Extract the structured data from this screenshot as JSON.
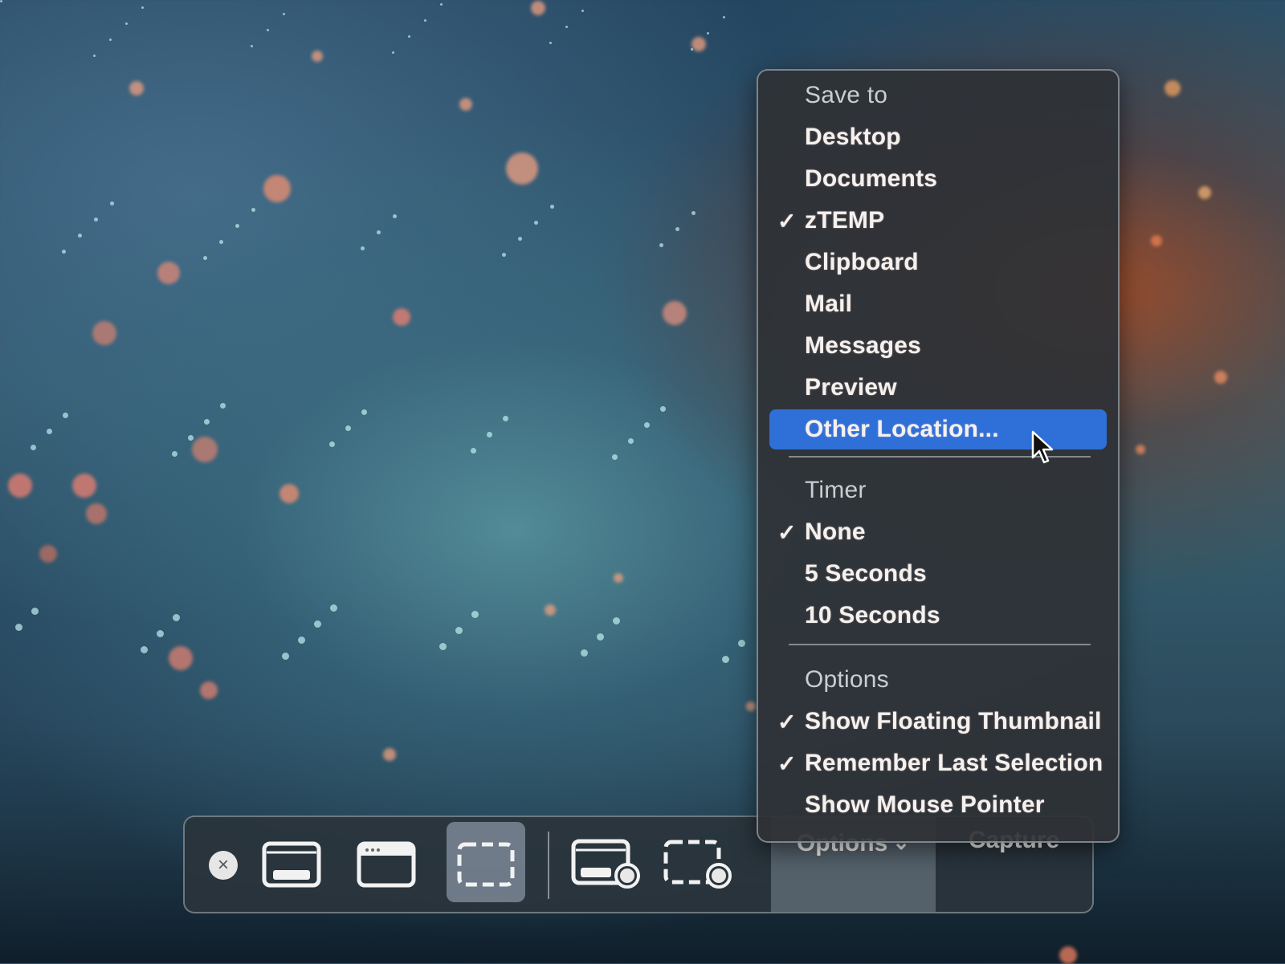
{
  "menu": {
    "sections": [
      {
        "header": "Save to",
        "items": [
          {
            "label": "Desktop",
            "checked": false
          },
          {
            "label": "Documents",
            "checked": false
          },
          {
            "label": "zTEMP",
            "checked": true
          },
          {
            "label": "Clipboard",
            "checked": false
          },
          {
            "label": "Mail",
            "checked": false
          },
          {
            "label": "Messages",
            "checked": false
          },
          {
            "label": "Preview",
            "checked": false
          },
          {
            "label": "Other Location...",
            "checked": false,
            "highlighted": true
          }
        ]
      },
      {
        "header": "Timer",
        "items": [
          {
            "label": "None",
            "checked": true
          },
          {
            "label": "5 Seconds",
            "checked": false
          },
          {
            "label": "10 Seconds",
            "checked": false
          }
        ]
      },
      {
        "header": "Options",
        "items": [
          {
            "label": "Show Floating Thumbnail",
            "checked": true
          },
          {
            "label": "Remember Last Selection",
            "checked": true
          },
          {
            "label": "Show Mouse Pointer",
            "checked": false
          }
        ]
      }
    ],
    "check_glyph": "✓",
    "highlight_color": "#2f6fd8"
  },
  "toolbar": {
    "close_icon": "×",
    "tools": [
      {
        "name": "capture-entire-screen",
        "icon": "screen-icon"
      },
      {
        "name": "capture-selected-window",
        "icon": "window-icon"
      },
      {
        "name": "capture-selected-portion",
        "icon": "dashed-rect-icon",
        "selected": true
      },
      {
        "name": "record-entire-screen",
        "icon": "screen-record-icon"
      },
      {
        "name": "record-selected-portion",
        "icon": "dashed-record-icon"
      }
    ],
    "options_label": "Options",
    "options_chevron": "⌄",
    "capture_label": "Capture"
  }
}
